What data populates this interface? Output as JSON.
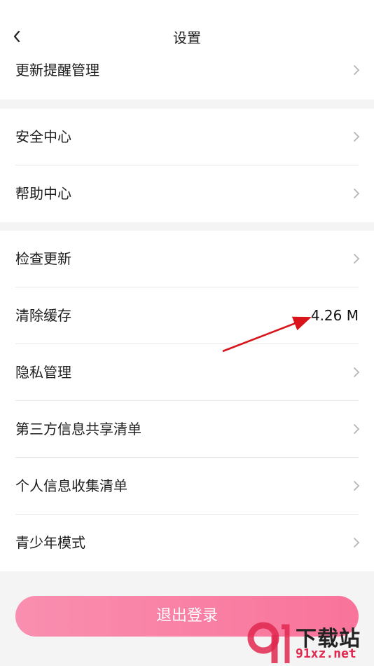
{
  "header": {
    "title": "设置",
    "back_icon": "chevron-left-icon"
  },
  "groups": [
    {
      "items": [
        {
          "label": "更新提醒管理",
          "has_chevron": true
        }
      ]
    },
    {
      "items": [
        {
          "label": "安全中心",
          "has_chevron": true
        },
        {
          "label": "帮助中心",
          "has_chevron": true
        }
      ]
    },
    {
      "items": [
        {
          "label": "检查更新",
          "has_chevron": true
        },
        {
          "label": "清除缓存",
          "value": "4.26 M",
          "has_chevron": false
        },
        {
          "label": "隐私管理",
          "has_chevron": true
        },
        {
          "label": "第三方信息共享清单",
          "has_chevron": true
        },
        {
          "label": "个人信息收集清单",
          "has_chevron": true
        },
        {
          "label": "青少年模式",
          "has_chevron": true
        }
      ]
    }
  ],
  "logout": {
    "label": "退出登录"
  },
  "annotation": {
    "type": "red-arrow",
    "color": "#d9141b"
  },
  "watermark": {
    "text": "下载站",
    "url": "91xz.net",
    "logo_color": "#e0284f"
  }
}
